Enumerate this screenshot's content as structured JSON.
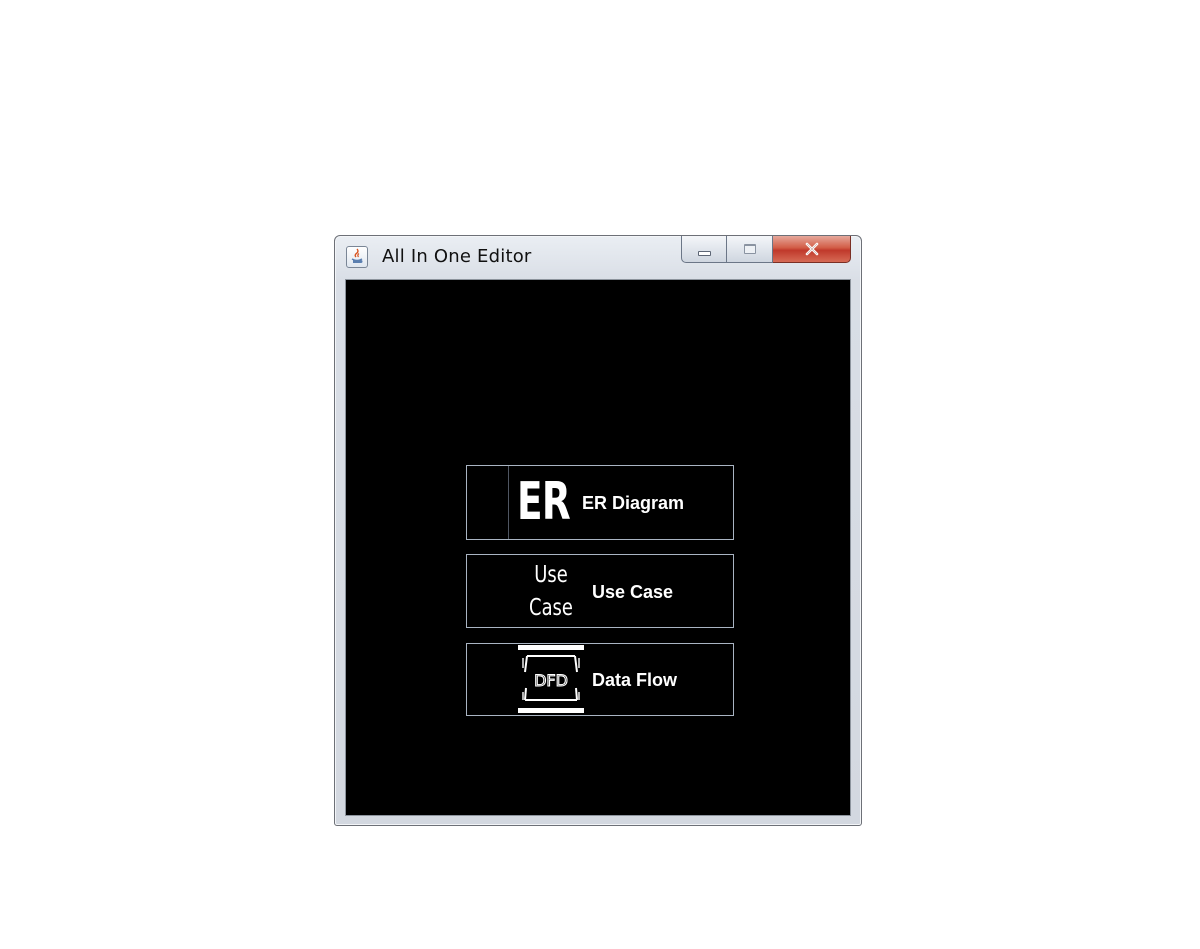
{
  "window": {
    "title": "All In One Editor",
    "icon": "java-coffee-icon",
    "controls": [
      "minimize-icon",
      "maximize-icon",
      "close-icon"
    ]
  },
  "buttons": [
    {
      "icon_text": "ER",
      "label": "ER Diagram"
    },
    {
      "icon_lines": [
        "Use",
        "Case"
      ],
      "label": "Use Case"
    },
    {
      "icon_text": "DFD",
      "label": "Data Flow"
    }
  ],
  "colors": {
    "background": "#000000",
    "button_border": "#a9b4c2",
    "text": "#ffffff",
    "close_button": "#c0392b"
  }
}
